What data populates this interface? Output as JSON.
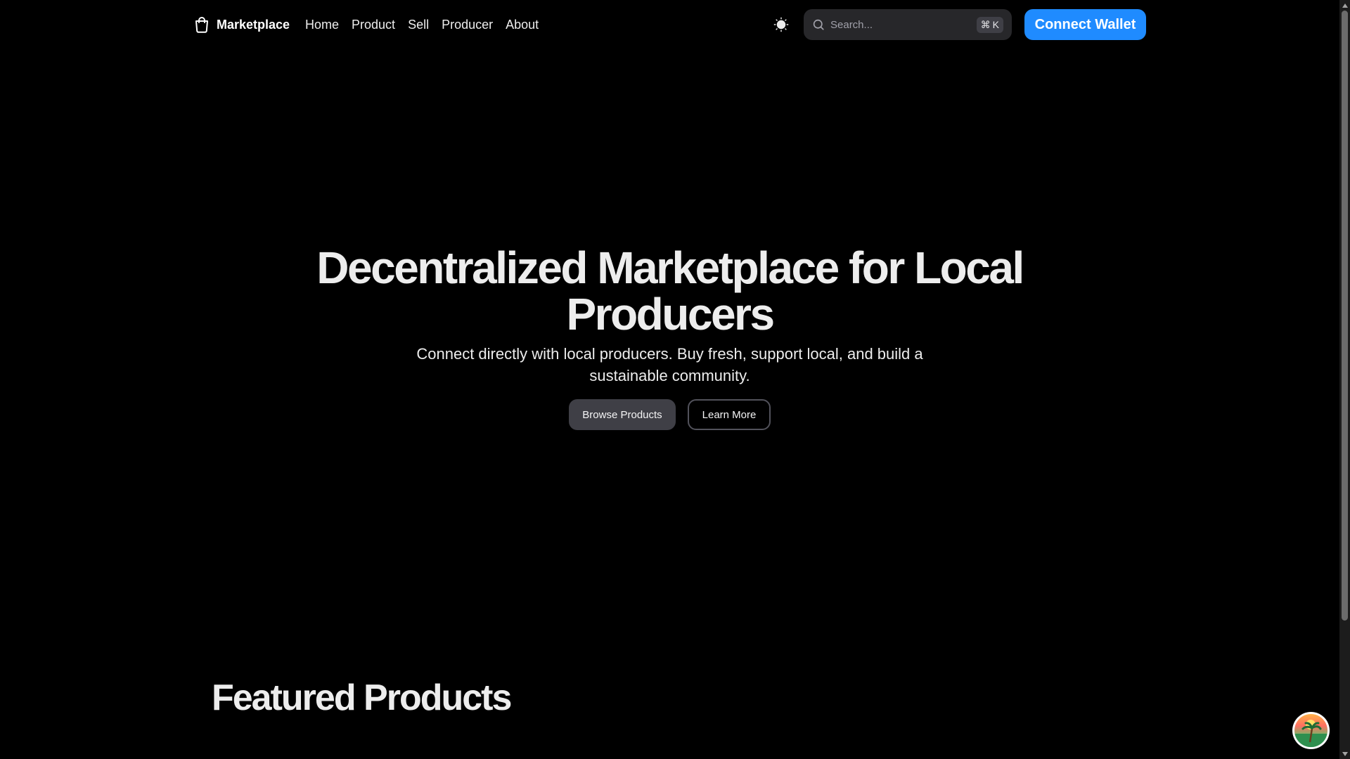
{
  "header": {
    "brand": {
      "name": "Marketplace",
      "icon": "shopping-bag-icon"
    },
    "nav": [
      {
        "label": "Home"
      },
      {
        "label": "Product"
      },
      {
        "label": "Sell"
      },
      {
        "label": "Producer"
      },
      {
        "label": "About"
      }
    ],
    "theme_toggle_icon": "sun-icon",
    "search": {
      "placeholder": "Search...",
      "value": "",
      "shortcut_symbol": "⌘",
      "shortcut_key": "K",
      "icon": "search-icon"
    },
    "connect_wallet_label": "Connect Wallet"
  },
  "hero": {
    "title": "Decentralized Marketplace for Local Producers",
    "subtitle": "Connect directly with local producers. Buy fresh, support local, and build a sustainable community.",
    "primary_label": "Browse Products",
    "secondary_label": "Learn More"
  },
  "featured": {
    "title": "Featured Products"
  },
  "colors": {
    "background": "#000000",
    "accent": "#1f8bff",
    "primary_button": "#3f3f46",
    "search_bg": "#27272a",
    "text": "#ededed"
  },
  "floating_avatar": {
    "icon": "palm-tree-sunset-icon"
  }
}
